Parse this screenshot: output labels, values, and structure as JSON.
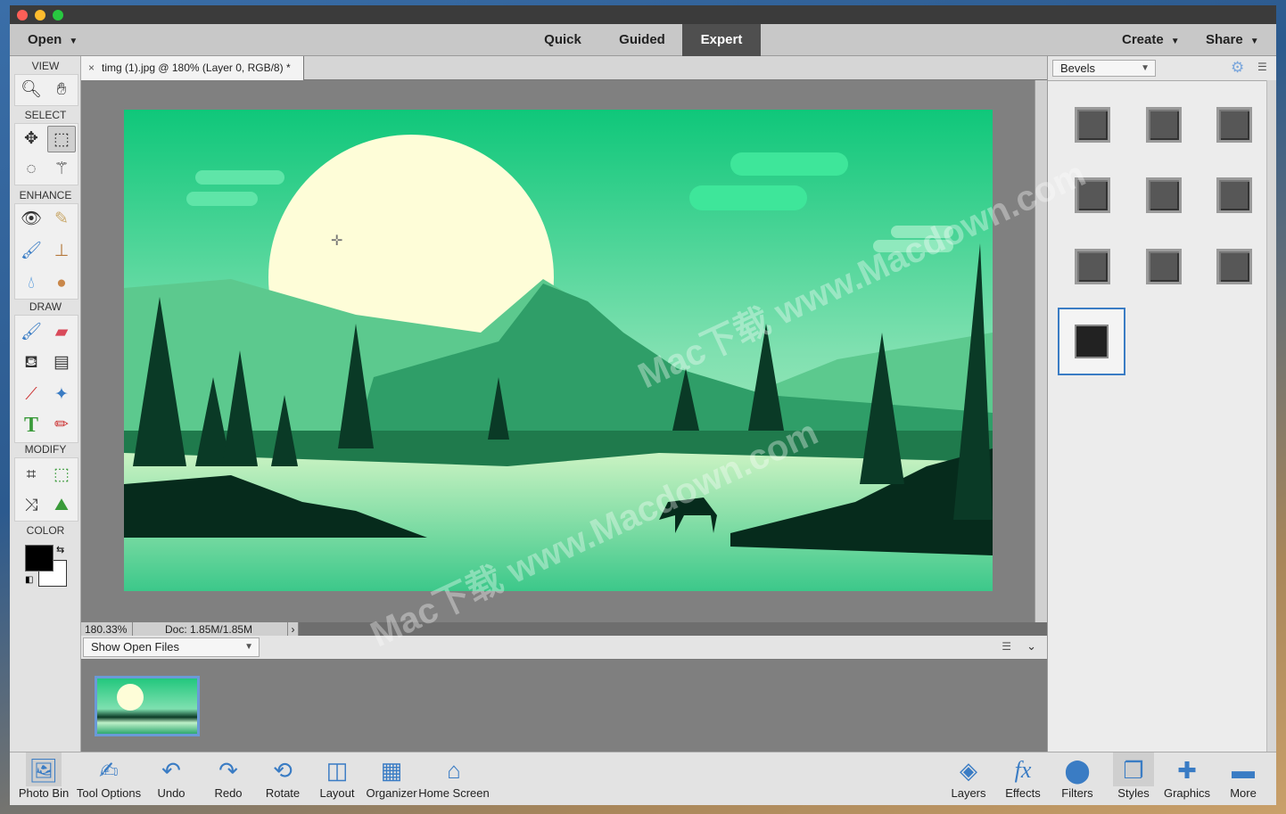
{
  "topbar": {
    "open_label": "Open",
    "modes": [
      "Quick",
      "Guided",
      "Expert"
    ],
    "active_mode": "Expert",
    "create_label": "Create",
    "share_label": "Share"
  },
  "toolbox": {
    "sections": {
      "view": "VIEW",
      "select": "SELECT",
      "enhance": "ENHANCE",
      "draw": "DRAW",
      "modify": "MODIFY",
      "color": "COLOR"
    },
    "colors": {
      "foreground": "#000000",
      "background": "#ffffff"
    }
  },
  "document": {
    "tab_title": "timg (1).jpg @ 180% (Layer 0, RGB/8) *",
    "close_icon": "×"
  },
  "status": {
    "zoom": "180.33%",
    "doc_size": "Doc: 1.85M/1.85M"
  },
  "photo_bin": {
    "dropdown_value": "Show Open Files"
  },
  "styles_panel": {
    "dropdown_value": "Bevels",
    "swatch_count": 10
  },
  "taskbar": {
    "left": [
      {
        "label": "Photo Bin",
        "icon": "photo-bin-icon"
      },
      {
        "label": "Tool Options",
        "icon": "tool-options-icon"
      },
      {
        "label": "Undo",
        "icon": "undo-icon"
      },
      {
        "label": "Redo",
        "icon": "redo-icon"
      },
      {
        "label": "Rotate",
        "icon": "rotate-icon"
      },
      {
        "label": "Layout",
        "icon": "layout-icon"
      },
      {
        "label": "Organizer",
        "icon": "organizer-icon"
      },
      {
        "label": "Home Screen",
        "icon": "home-icon"
      }
    ],
    "right": [
      {
        "label": "Layers",
        "icon": "layers-icon"
      },
      {
        "label": "Effects",
        "icon": "fx-icon"
      },
      {
        "label": "Filters",
        "icon": "filters-icon"
      },
      {
        "label": "Styles",
        "icon": "styles-icon"
      },
      {
        "label": "Graphics",
        "icon": "plus-icon"
      },
      {
        "label": "More",
        "icon": "more-icon"
      }
    ]
  },
  "watermark": "Mac下载 www.Macdown.com"
}
